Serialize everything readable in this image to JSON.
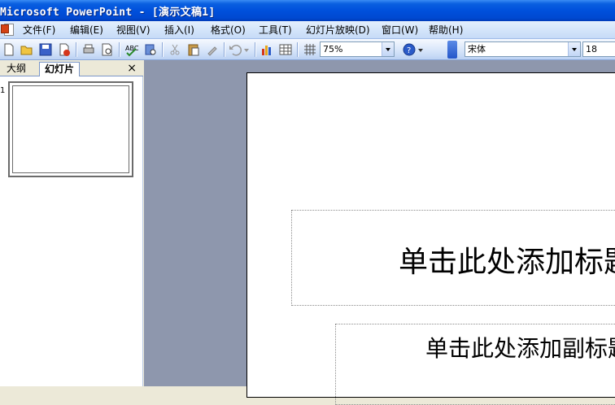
{
  "window": {
    "title": "Microsoft PowerPoint - [演示文稿1]"
  },
  "menu": {
    "items": [
      {
        "label": "文件(F)"
      },
      {
        "label": "编辑(E)"
      },
      {
        "label": "视图(V)"
      },
      {
        "label": "插入(I)"
      },
      {
        "label": "格式(O)"
      },
      {
        "label": "工具(T)"
      },
      {
        "label": "幻灯片放映(D)"
      },
      {
        "label": "窗口(W)"
      },
      {
        "label": "帮助(H)"
      }
    ]
  },
  "toolbar": {
    "zoom_value": "75%",
    "font_name": "宋体",
    "font_size": "18"
  },
  "panel": {
    "tabs": [
      {
        "label": "大纲"
      },
      {
        "label": "幻灯片"
      }
    ],
    "close_label": "×",
    "slide_number": "1"
  },
  "slide": {
    "title_placeholder": "单击此处添加标题",
    "subtitle_placeholder": "单击此处添加副标题"
  },
  "colors": {
    "titlebar": "#0050dc",
    "workarea": "#8e97ad",
    "menubar": "#c6dbf7"
  }
}
